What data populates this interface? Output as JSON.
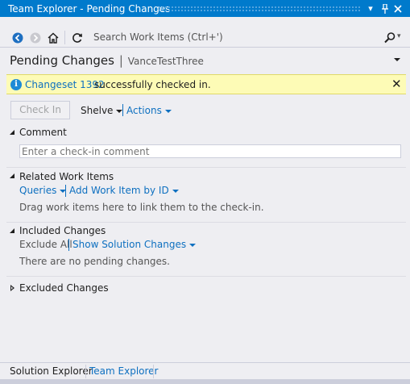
{
  "window": {
    "title": "Team Explorer - Pending Changes"
  },
  "navbar": {
    "search_placeholder": "Search Work Items (Ctrl+')"
  },
  "header": {
    "title": "Pending Changes",
    "separator": "|",
    "workspace": "VanceTestThree"
  },
  "notification": {
    "link": "Changeset 1392",
    "message": "successfully checked in.",
    "close": "✕"
  },
  "toolbar": {
    "check_in": "Check In",
    "shelve": "Shelve",
    "actions": "Actions"
  },
  "comment": {
    "title": "Comment",
    "placeholder": "Enter a check-in comment"
  },
  "related": {
    "title": "Related Work Items",
    "queries": "Queries",
    "add_by_id": "Add Work Item by ID",
    "hint": "Drag work items here to link them to the check-in."
  },
  "included": {
    "title": "Included Changes",
    "exclude_all": "Exclude All",
    "show_solution": "Show Solution Changes",
    "empty": "There are no pending changes."
  },
  "excluded": {
    "title": "Excluded Changes"
  },
  "tabs": {
    "solution_explorer": "Solution Explorer",
    "team_explorer": "Team Explorer"
  },
  "colors": {
    "title_bar": "#007acc",
    "link": "#0e70c0",
    "info_bar": "#fdfbb6",
    "background": "#eeeef2"
  }
}
